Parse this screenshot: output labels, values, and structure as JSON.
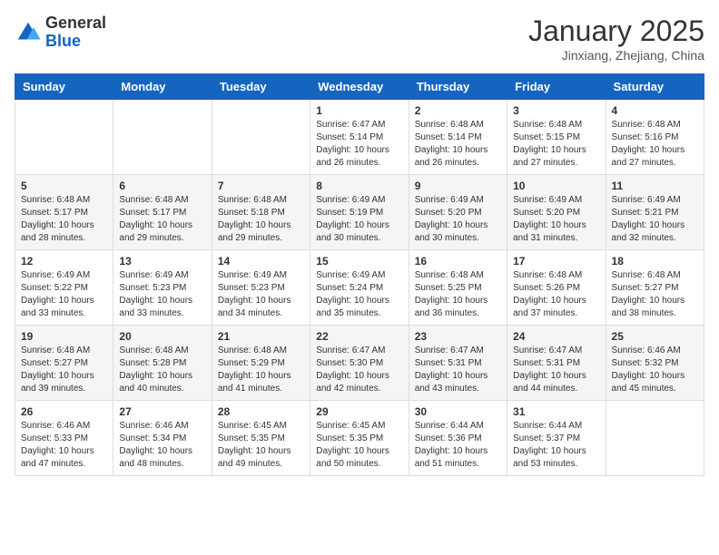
{
  "header": {
    "logo_general": "General",
    "logo_blue": "Blue",
    "month_title": "January 2025",
    "subtitle": "Jinxiang, Zhejiang, China"
  },
  "weekdays": [
    "Sunday",
    "Monday",
    "Tuesday",
    "Wednesday",
    "Thursday",
    "Friday",
    "Saturday"
  ],
  "weeks": [
    [
      {
        "day": "",
        "info": ""
      },
      {
        "day": "",
        "info": ""
      },
      {
        "day": "",
        "info": ""
      },
      {
        "day": "1",
        "info": "Sunrise: 6:47 AM\nSunset: 5:14 PM\nDaylight: 10 hours and 26 minutes."
      },
      {
        "day": "2",
        "info": "Sunrise: 6:48 AM\nSunset: 5:14 PM\nDaylight: 10 hours and 26 minutes."
      },
      {
        "day": "3",
        "info": "Sunrise: 6:48 AM\nSunset: 5:15 PM\nDaylight: 10 hours and 27 minutes."
      },
      {
        "day": "4",
        "info": "Sunrise: 6:48 AM\nSunset: 5:16 PM\nDaylight: 10 hours and 27 minutes."
      }
    ],
    [
      {
        "day": "5",
        "info": "Sunrise: 6:48 AM\nSunset: 5:17 PM\nDaylight: 10 hours and 28 minutes."
      },
      {
        "day": "6",
        "info": "Sunrise: 6:48 AM\nSunset: 5:17 PM\nDaylight: 10 hours and 29 minutes."
      },
      {
        "day": "7",
        "info": "Sunrise: 6:48 AM\nSunset: 5:18 PM\nDaylight: 10 hours and 29 minutes."
      },
      {
        "day": "8",
        "info": "Sunrise: 6:49 AM\nSunset: 5:19 PM\nDaylight: 10 hours and 30 minutes."
      },
      {
        "day": "9",
        "info": "Sunrise: 6:49 AM\nSunset: 5:20 PM\nDaylight: 10 hours and 30 minutes."
      },
      {
        "day": "10",
        "info": "Sunrise: 6:49 AM\nSunset: 5:20 PM\nDaylight: 10 hours and 31 minutes."
      },
      {
        "day": "11",
        "info": "Sunrise: 6:49 AM\nSunset: 5:21 PM\nDaylight: 10 hours and 32 minutes."
      }
    ],
    [
      {
        "day": "12",
        "info": "Sunrise: 6:49 AM\nSunset: 5:22 PM\nDaylight: 10 hours and 33 minutes."
      },
      {
        "day": "13",
        "info": "Sunrise: 6:49 AM\nSunset: 5:23 PM\nDaylight: 10 hours and 33 minutes."
      },
      {
        "day": "14",
        "info": "Sunrise: 6:49 AM\nSunset: 5:23 PM\nDaylight: 10 hours and 34 minutes."
      },
      {
        "day": "15",
        "info": "Sunrise: 6:49 AM\nSunset: 5:24 PM\nDaylight: 10 hours and 35 minutes."
      },
      {
        "day": "16",
        "info": "Sunrise: 6:48 AM\nSunset: 5:25 PM\nDaylight: 10 hours and 36 minutes."
      },
      {
        "day": "17",
        "info": "Sunrise: 6:48 AM\nSunset: 5:26 PM\nDaylight: 10 hours and 37 minutes."
      },
      {
        "day": "18",
        "info": "Sunrise: 6:48 AM\nSunset: 5:27 PM\nDaylight: 10 hours and 38 minutes."
      }
    ],
    [
      {
        "day": "19",
        "info": "Sunrise: 6:48 AM\nSunset: 5:27 PM\nDaylight: 10 hours and 39 minutes."
      },
      {
        "day": "20",
        "info": "Sunrise: 6:48 AM\nSunset: 5:28 PM\nDaylight: 10 hours and 40 minutes."
      },
      {
        "day": "21",
        "info": "Sunrise: 6:48 AM\nSunset: 5:29 PM\nDaylight: 10 hours and 41 minutes."
      },
      {
        "day": "22",
        "info": "Sunrise: 6:47 AM\nSunset: 5:30 PM\nDaylight: 10 hours and 42 minutes."
      },
      {
        "day": "23",
        "info": "Sunrise: 6:47 AM\nSunset: 5:31 PM\nDaylight: 10 hours and 43 minutes."
      },
      {
        "day": "24",
        "info": "Sunrise: 6:47 AM\nSunset: 5:31 PM\nDaylight: 10 hours and 44 minutes."
      },
      {
        "day": "25",
        "info": "Sunrise: 6:46 AM\nSunset: 5:32 PM\nDaylight: 10 hours and 45 minutes."
      }
    ],
    [
      {
        "day": "26",
        "info": "Sunrise: 6:46 AM\nSunset: 5:33 PM\nDaylight: 10 hours and 47 minutes."
      },
      {
        "day": "27",
        "info": "Sunrise: 6:46 AM\nSunset: 5:34 PM\nDaylight: 10 hours and 48 minutes."
      },
      {
        "day": "28",
        "info": "Sunrise: 6:45 AM\nSunset: 5:35 PM\nDaylight: 10 hours and 49 minutes."
      },
      {
        "day": "29",
        "info": "Sunrise: 6:45 AM\nSunset: 5:35 PM\nDaylight: 10 hours and 50 minutes."
      },
      {
        "day": "30",
        "info": "Sunrise: 6:44 AM\nSunset: 5:36 PM\nDaylight: 10 hours and 51 minutes."
      },
      {
        "day": "31",
        "info": "Sunrise: 6:44 AM\nSunset: 5:37 PM\nDaylight: 10 hours and 53 minutes."
      },
      {
        "day": "",
        "info": ""
      }
    ]
  ]
}
